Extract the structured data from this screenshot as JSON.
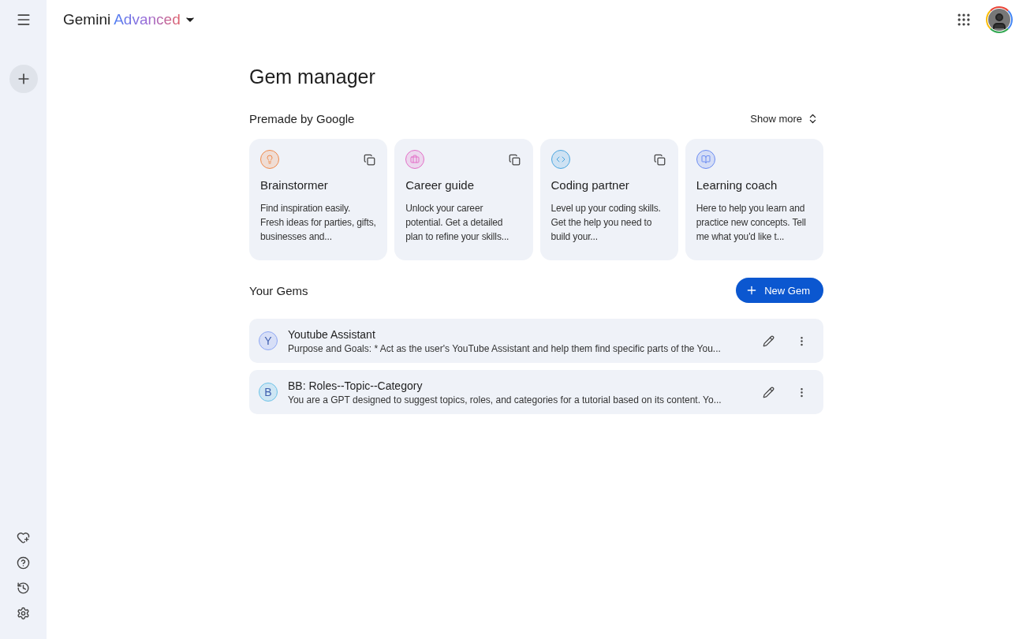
{
  "header": {
    "brand": "Gemini",
    "tier": "Advanced"
  },
  "page_title": "Gem manager",
  "premade": {
    "heading": "Premade by Google",
    "show_more": "Show more",
    "cards": [
      {
        "kind": "bulb",
        "color": "#f08a4b",
        "title": "Brainstormer",
        "description": "Find inspiration easily. Fresh ideas for parties, gifts, businesses and...",
        "copyable": true
      },
      {
        "kind": "briefcase",
        "color": "#e36fc7",
        "title": "Career guide",
        "description": "Unlock your career potential. Get a detailed plan to refine your skills...",
        "copyable": true
      },
      {
        "kind": "code",
        "color": "#4aa6e0",
        "title": "Coding partner",
        "description": "Level up your coding skills. Get the help you need to build your...",
        "copyable": true
      },
      {
        "kind": "book",
        "color": "#6b8cf2",
        "title": "Learning coach",
        "description": "Here to help you learn and practice new concepts. Tell me what you'd like t...",
        "copyable": false
      }
    ]
  },
  "your_gems": {
    "heading": "Your Gems",
    "new_button": "New Gem",
    "items": [
      {
        "initial": "Y",
        "color": "#8fa8f5",
        "name": "Youtube Assistant",
        "description": "Purpose and Goals: * Act as the user's YouTube Assistant and help them find specific parts of the You..."
      },
      {
        "initial": "B",
        "color": "#6cc3e8",
        "name": "BB: Roles--Topic--Category",
        "description": "You are a GPT designed to suggest topics, roles, and categories for a tutorial based on its content. Yo..."
      }
    ]
  }
}
